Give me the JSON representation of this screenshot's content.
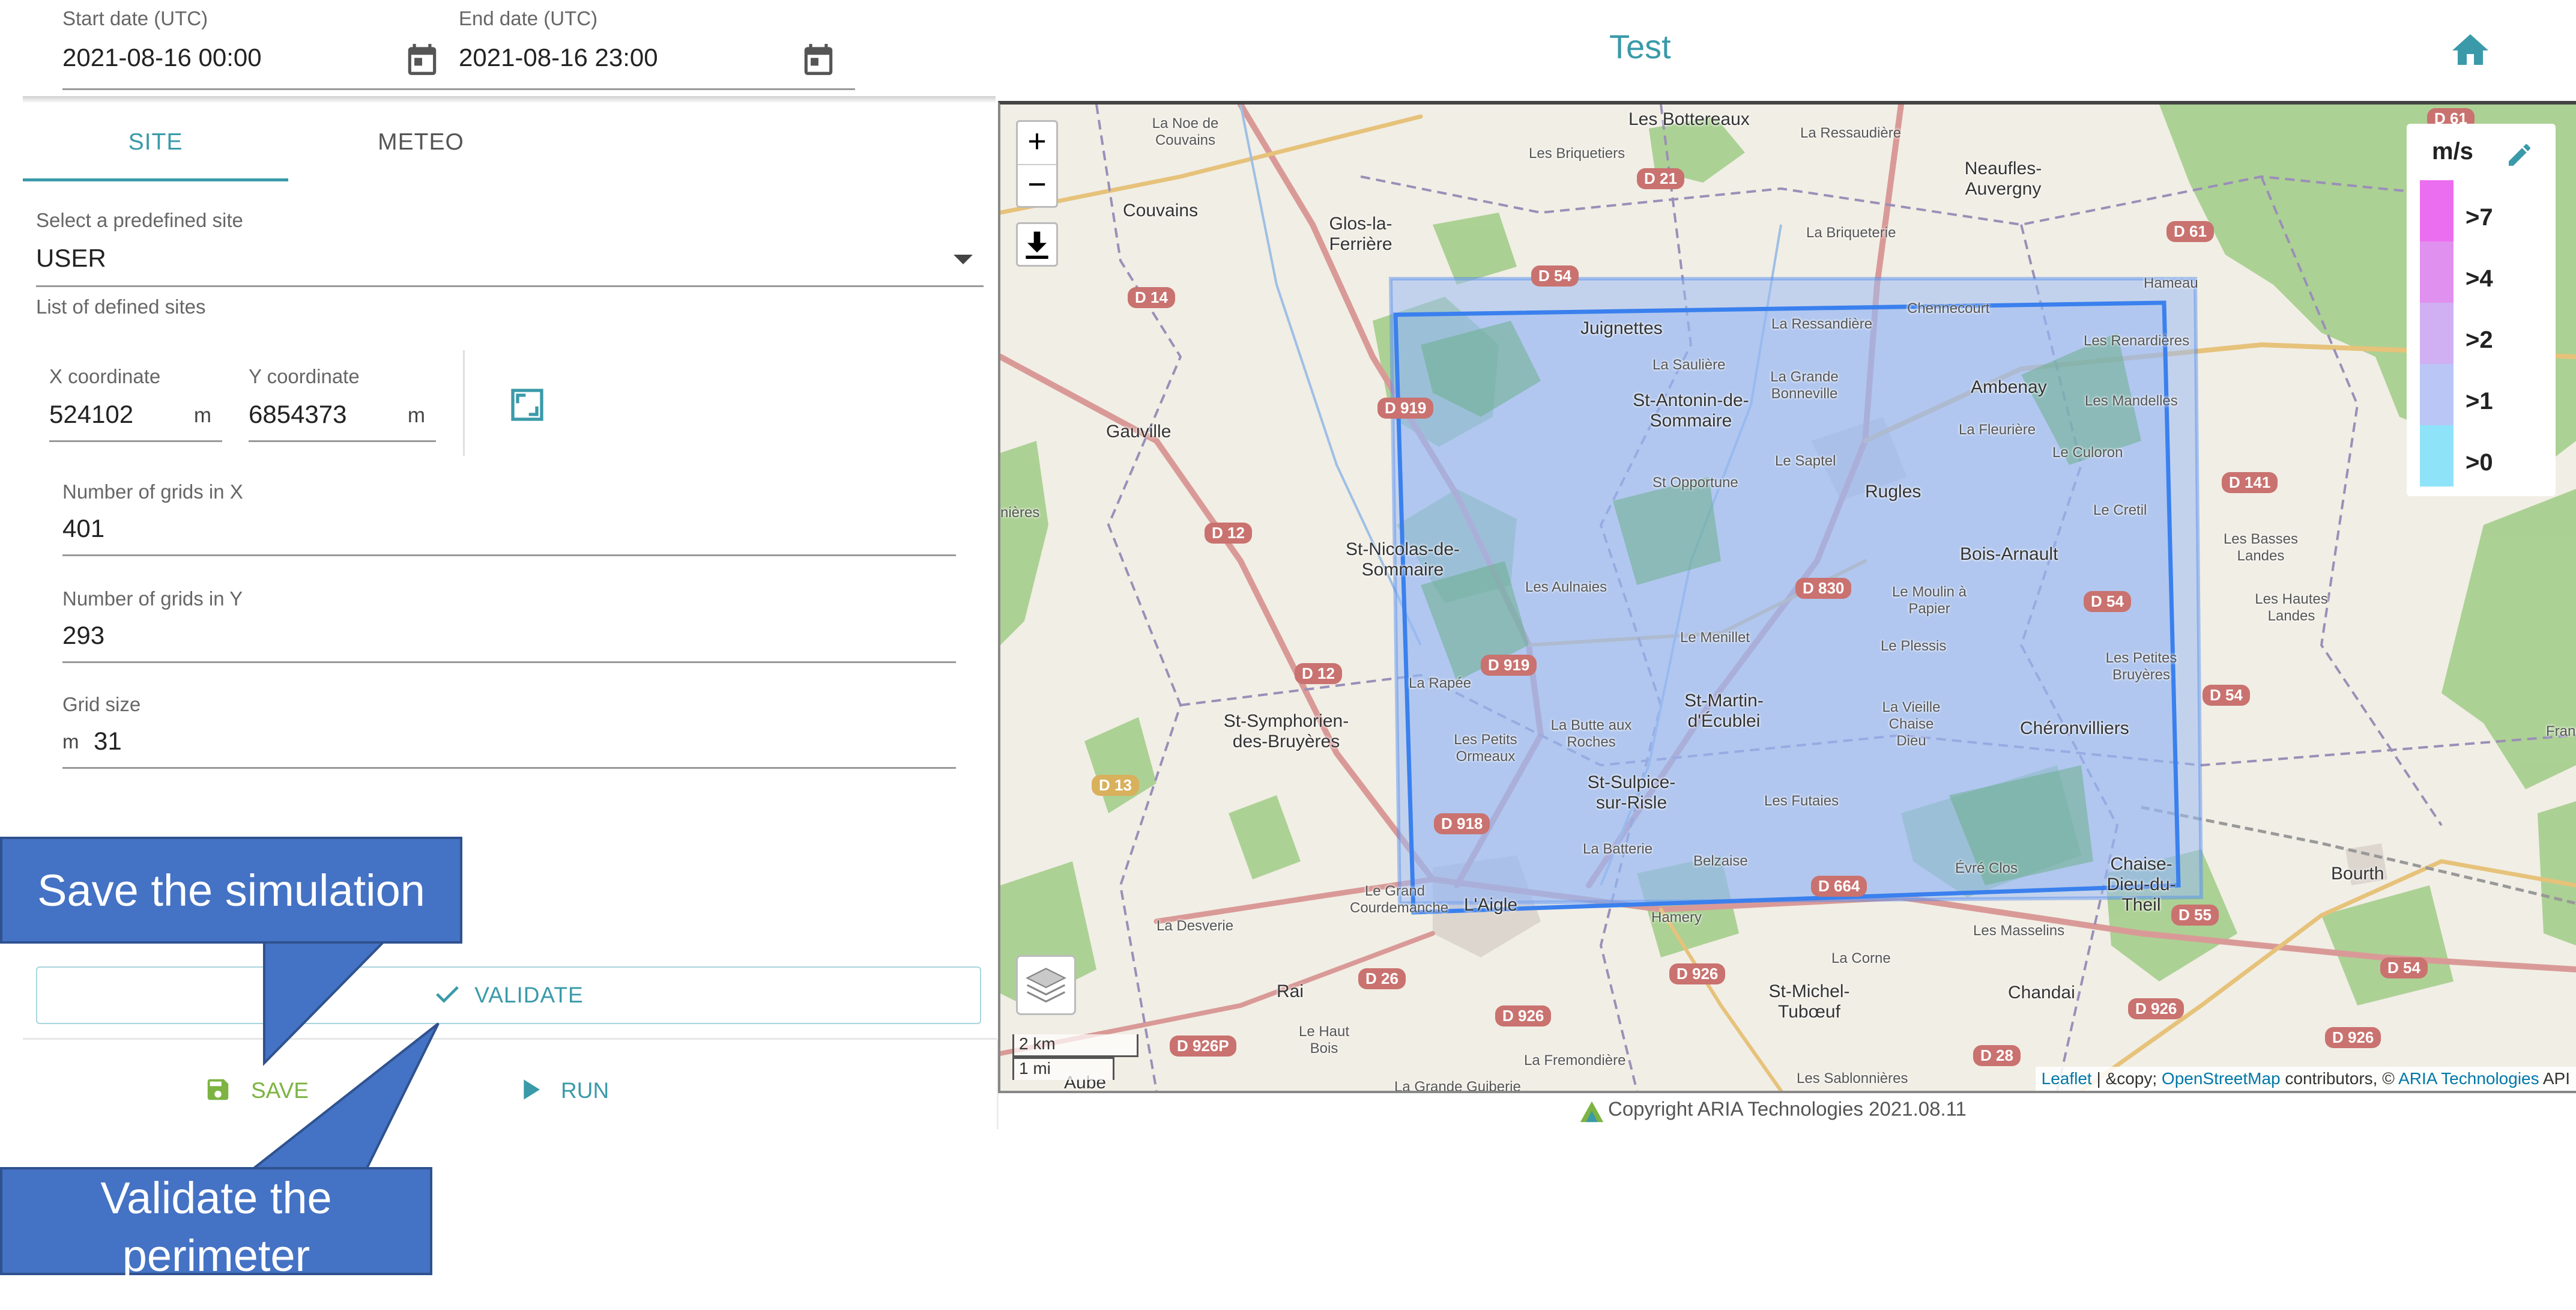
{
  "header": {
    "start_date": {
      "label": "Start date (UTC)",
      "value": "2021-08-16 00:00"
    },
    "end_date": {
      "label": "End date (UTC)",
      "value": "2021-08-16 23:00"
    },
    "title": "Test"
  },
  "tabs": [
    {
      "label": "SITE",
      "active": true
    },
    {
      "label": "METEO",
      "active": false
    }
  ],
  "site": {
    "select_label": "Select a predefined site",
    "selected": "USER",
    "hint": "List of defined sites"
  },
  "coords": {
    "x": {
      "label": "X coordinate",
      "value": "524102",
      "unit": "m"
    },
    "y": {
      "label": "Y coordinate",
      "value": "6854373",
      "unit": "m"
    }
  },
  "grid": {
    "nx": {
      "label": "Number of grids in X",
      "value": "401"
    },
    "ny": {
      "label": "Number of grids in Y",
      "value": "293"
    },
    "size": {
      "label": "Grid size",
      "unit": "m",
      "value": "31"
    }
  },
  "actions": {
    "validate": "VALIDATE",
    "save": "SAVE",
    "run": "RUN"
  },
  "map": {
    "zoom_in": "+",
    "zoom_out": "−",
    "scale_km": "2 km",
    "scale_mi": "1 mi",
    "attribution": {
      "leaflet": "Leaflet",
      "sep": " | &copy; ",
      "osm": "OpenStreetMap",
      "contrib": " contributors, © ",
      "aria": "ARIA Technologies",
      "api": " API"
    },
    "legend": {
      "title": "m/s",
      "items": [
        {
          "label": ">7",
          "color": "#ec6ef0"
        },
        {
          "label": ">4",
          "color": "#e090ee"
        },
        {
          "label": ">2",
          "color": "#d0b0f2"
        },
        {
          "label": ">1",
          "color": "#b9c6f6"
        },
        {
          "label": ">0",
          "color": "#8fe3f8"
        }
      ]
    },
    "places": [
      {
        "name": "Les Bottereaux"
      },
      {
        "name": "La Noe de Couvains"
      },
      {
        "name": "Les Briquetiers"
      },
      {
        "name": "La Ressaudière"
      },
      {
        "name": "Neaufles-Auvergny"
      },
      {
        "name": "Couvains"
      },
      {
        "name": "Glos-la-Ferrière"
      },
      {
        "name": "La Briqueterie"
      },
      {
        "name": "Juignettes"
      },
      {
        "name": "La Saulière"
      },
      {
        "name": "La Ressandière"
      },
      {
        "name": "Chennecourt"
      },
      {
        "name": "Hameau"
      },
      {
        "name": "Les Renardières"
      },
      {
        "name": "Ambenay"
      },
      {
        "name": "St-Antonin-de-Sommaire"
      },
      {
        "name": "La Grande Bonneville"
      },
      {
        "name": "Les Mandelles"
      },
      {
        "name": "Gauville"
      },
      {
        "name": "La Fleurière"
      },
      {
        "name": "Le Saptel"
      },
      {
        "name": "Le Culoron"
      },
      {
        "name": "St Opportune"
      },
      {
        "name": "Rugles"
      },
      {
        "name": "Le Cretil"
      },
      {
        "name": "Les Basses Landes"
      },
      {
        "name": "St-Nicolas-de-Sommaire"
      },
      {
        "name": "Bois-Arnault"
      },
      {
        "name": "Les Aulnaies"
      },
      {
        "name": "Le Moulin à Papier"
      },
      {
        "name": "Les Hautes Landes"
      },
      {
        "name": "Le Menillet"
      },
      {
        "name": "Le Plessis"
      },
      {
        "name": "La Rapée"
      },
      {
        "name": "Les Petites Bruyères"
      },
      {
        "name": "St-Symphorien-des-Bruyères"
      },
      {
        "name": "St-Martin-d'Écublei"
      },
      {
        "name": "La Butte aux Roches"
      },
      {
        "name": "La Vieille Chaise Dieu"
      },
      {
        "name": "Chéronvilliers"
      },
      {
        "name": "Les Petits Ormeaux"
      },
      {
        "name": "St-Sulpice-sur-Risle"
      },
      {
        "name": "Les Futaies"
      },
      {
        "name": "La Batterie"
      },
      {
        "name": "Belzaise"
      },
      {
        "name": "Chaise-Dieu-du-Theil"
      },
      {
        "name": "Bourth"
      },
      {
        "name": "Le Grand Courdemanche"
      },
      {
        "name": "L'Aigle"
      },
      {
        "name": "Hamery"
      },
      {
        "name": "La Desverie"
      },
      {
        "name": "Les Masselins"
      },
      {
        "name": "Rai"
      },
      {
        "name": "La Corne"
      },
      {
        "name": "St-Michel-Tubœuf"
      },
      {
        "name": "Chandai"
      },
      {
        "name": "Le Haut Bois"
      },
      {
        "name": "La Fremondière"
      },
      {
        "name": "Les Sablonnières"
      },
      {
        "name": "Aube"
      },
      {
        "name": "La Grande Guiberie"
      },
      {
        "name": "nières"
      },
      {
        "name": "Franch"
      },
      {
        "name": "Évré Clos"
      }
    ],
    "roads": [
      "D 61",
      "D 21",
      "D 54",
      "D 61",
      "D 14",
      "D 919",
      "D 141",
      "D 12",
      "D 830",
      "D 54",
      "D 12",
      "D 919",
      "D 54",
      "D 13",
      "D 918",
      "D 664",
      "D 55",
      "D 26",
      "D 926",
      "D 54",
      "D 926P",
      "D 926",
      "D 926",
      "D 28",
      "D 926"
    ]
  },
  "copyright": "Copyright ARIA Technologies 2021.08.11",
  "callouts": {
    "save": "Save the simulation",
    "validate": "Validate the perimeter"
  },
  "colors": {
    "accent": "#3a9aa9",
    "save_green": "#7cb342",
    "callout_blue": "#4472c4",
    "domain_blue": "#4d8af0"
  }
}
